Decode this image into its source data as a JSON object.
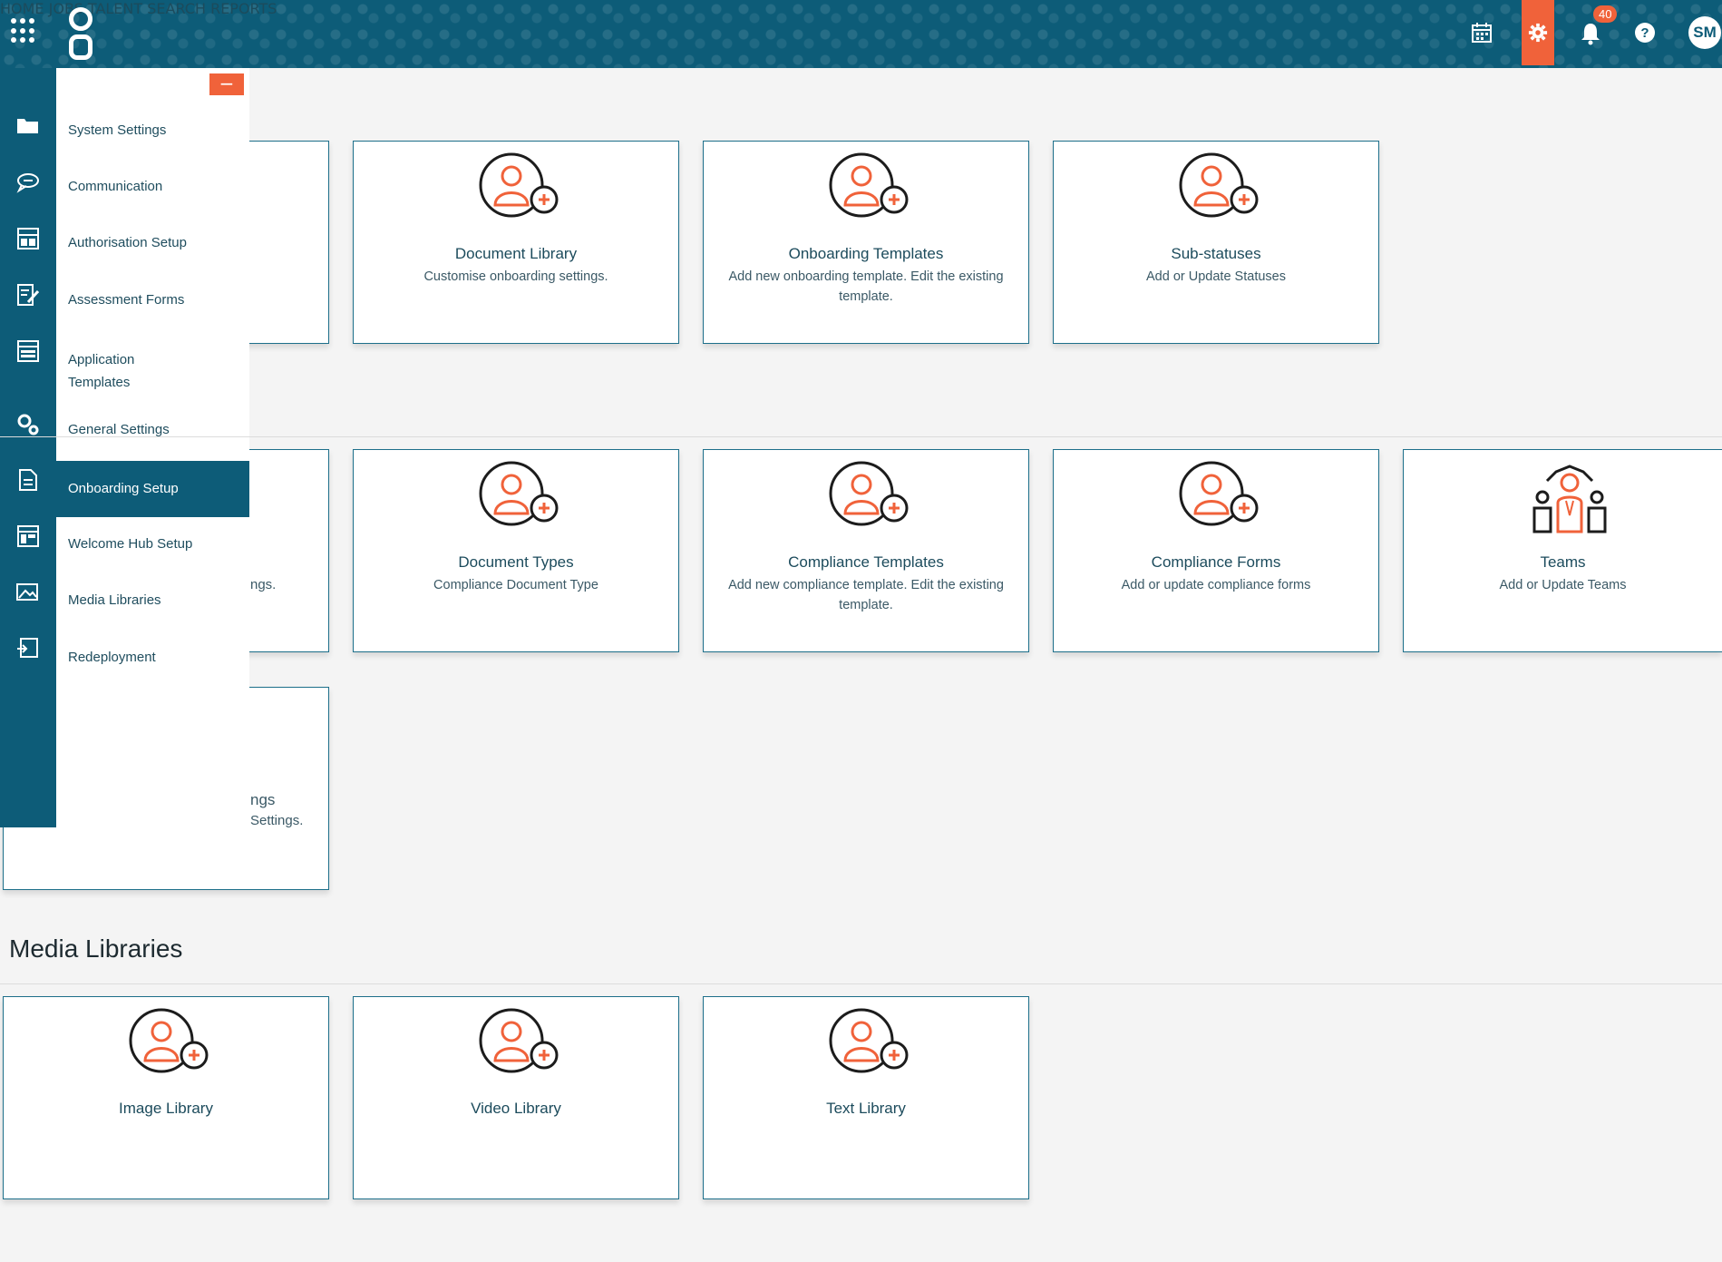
{
  "topbar": {
    "nav": [
      "HOME",
      "JOBS",
      "TALENT",
      "SEARCH",
      "REPORTS"
    ],
    "notifications_count": "40",
    "avatar_initials": "SM"
  },
  "sidebar": {
    "items": [
      {
        "label": "System Settings",
        "icon": "folder-icon"
      },
      {
        "label": "Communication",
        "icon": "chat-icon"
      },
      {
        "label": "Authorisation Setup",
        "icon": "layout-icon"
      },
      {
        "label": "Assessment Forms",
        "icon": "edit-form-icon"
      },
      {
        "label": "Application Templates",
        "icon": "template-icon"
      },
      {
        "label": "General Settings",
        "icon": "gears-icon"
      },
      {
        "label": "Onboarding Setup",
        "icon": "document-icon",
        "active": true
      },
      {
        "label": "Welcome Hub Setup",
        "icon": "dashboard-icon"
      },
      {
        "label": "Media Libraries",
        "icon": "image-icon"
      },
      {
        "label": "Redeployment",
        "icon": "redeploy-icon"
      }
    ]
  },
  "cards_row1": [
    {
      "title": "Document Library",
      "desc": "Customise onboarding settings."
    },
    {
      "title": "Onboarding Templates",
      "desc": "Add new onboarding template. Edit the existing template."
    },
    {
      "title": "Sub-statuses",
      "desc": "Add or Update Statuses"
    }
  ],
  "cards_row2": [
    {
      "title": "Document Types",
      "desc": "Compliance Document Type"
    },
    {
      "title": "Compliance Templates",
      "desc": "Add new compliance template. Edit the existing template."
    },
    {
      "title": "Compliance Forms",
      "desc": "Add or update compliance forms"
    },
    {
      "title": "Teams",
      "desc": "Add or Update Teams"
    }
  ],
  "partial": {
    "row2_text": "ngs.",
    "row3_title": "ngs",
    "row3_desc": "Settings."
  },
  "media_section": {
    "title": "Media Libraries",
    "cards": [
      {
        "title": "Image Library"
      },
      {
        "title": "Video Library"
      },
      {
        "title": "Text Library"
      }
    ]
  },
  "colors": {
    "primary": "#0d5c78",
    "accent": "#f0623a"
  }
}
